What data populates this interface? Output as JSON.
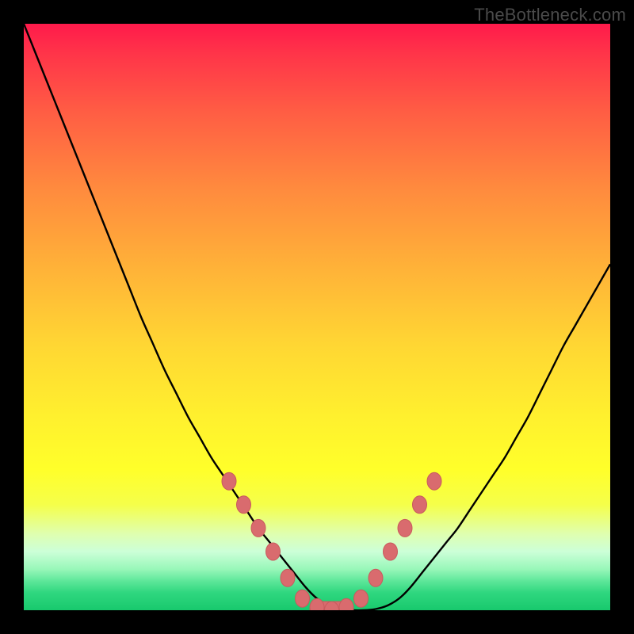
{
  "watermark": "TheBottleneck.com",
  "colors": {
    "frame": "#000000",
    "curve": "#000000",
    "markers": "#d96b6e",
    "markers_edge": "#c95a5d"
  },
  "chart_data": {
    "type": "line",
    "title": "",
    "xlabel": "",
    "ylabel": "",
    "xlim": [
      0,
      100
    ],
    "ylim": [
      0,
      100
    ],
    "grid": false,
    "legend": false,
    "x": [
      0,
      2,
      4,
      6,
      8,
      10,
      12,
      14,
      16,
      18,
      20,
      22,
      24,
      26,
      28,
      30,
      32,
      34,
      36,
      38,
      40,
      42,
      44,
      46,
      48,
      50,
      52,
      54,
      56,
      58,
      60,
      62,
      64,
      66,
      68,
      70,
      72,
      74,
      76,
      78,
      80,
      82,
      84,
      86,
      88,
      90,
      92,
      94,
      96,
      98,
      100
    ],
    "y": [
      100,
      95,
      90,
      85,
      80,
      75,
      70,
      65,
      60,
      55,
      50,
      45.5,
      41,
      37,
      33,
      29.5,
      26,
      23,
      20,
      17,
      14,
      11.5,
      9,
      6.5,
      4,
      2,
      0.8,
      0.2,
      0,
      0,
      0.2,
      0.8,
      2,
      4,
      6.5,
      9,
      11.5,
      14,
      17,
      20,
      23,
      26,
      29.5,
      33,
      37,
      41,
      45,
      48.5,
      52,
      55.5,
      59
    ],
    "markers": {
      "x": [
        35,
        37.5,
        40,
        42.5,
        45,
        47.5,
        50,
        52.5,
        55,
        57.5,
        60,
        62.5,
        65,
        67.5,
        70
      ],
      "y": [
        22,
        18,
        14,
        10,
        5.5,
        2,
        0.5,
        0,
        0.5,
        2,
        5.5,
        10,
        14,
        18,
        22
      ]
    }
  }
}
